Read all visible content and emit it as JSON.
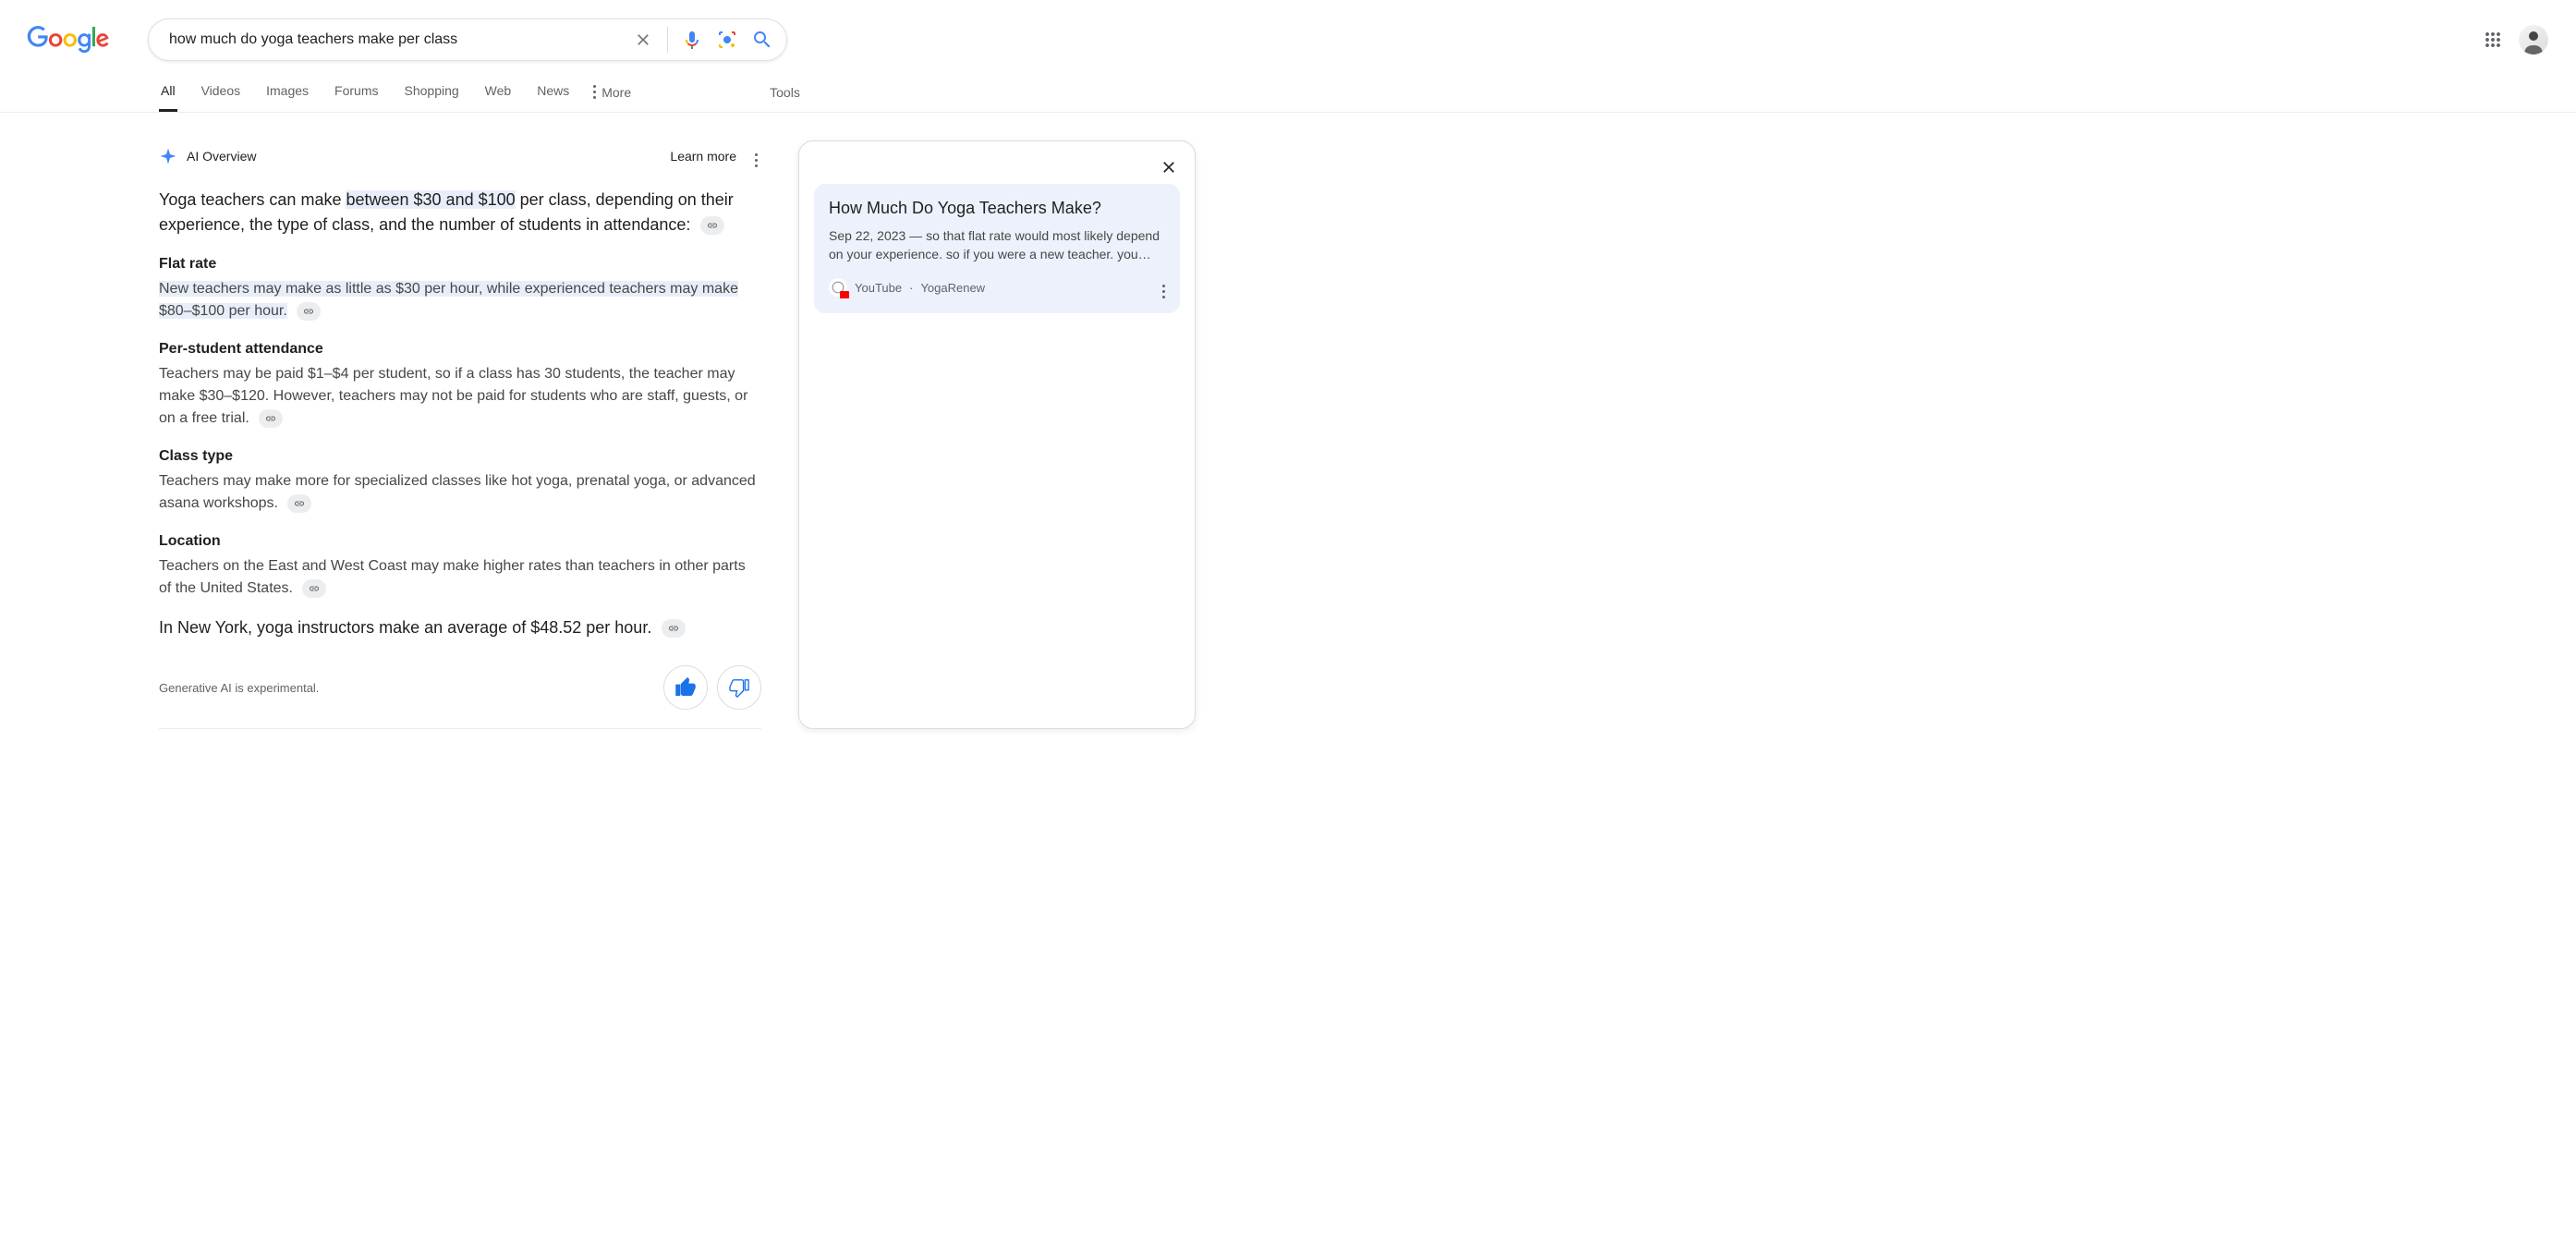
{
  "search": {
    "query": "how much do yoga teachers make per class"
  },
  "nav": {
    "tabs": [
      "All",
      "Videos",
      "Images",
      "Forums",
      "Shopping",
      "Web",
      "News"
    ],
    "more": "More",
    "tools": "Tools"
  },
  "ai": {
    "badge": "AI Overview",
    "learn_more": "Learn more",
    "intro_pre": "Yoga teachers can make ",
    "intro_hl1": "between $30 and $100",
    "intro_mid": " per class, depending on their experience, the type of class, and the number of students in attendance:",
    "sections": [
      {
        "title": "Flat rate",
        "body": "New teachers may make as little as $30 per hour, while experienced teachers may make $80–$100 per hour.",
        "highlighted": true
      },
      {
        "title": "Per-student attendance",
        "body": "Teachers may be paid $1–$4 per student, so if a class has 30 students, the teacher may make $30–$120. However, teachers may not be paid for students who are staff, guests, or on a free trial.",
        "highlighted": false
      },
      {
        "title": "Class type",
        "body": "Teachers may make more for specialized classes like hot yoga, prenatal yoga, or advanced asana workshops.",
        "highlighted": false
      },
      {
        "title": "Location",
        "body": "Teachers on the East and West Coast may make higher rates than teachers in other parts of the United States.",
        "highlighted": false
      }
    ],
    "closing": "In New York, yoga instructors make an average of $48.52 per hour.",
    "disclaimer": "Generative AI is experimental."
  },
  "source_card": {
    "title": "How Much Do Yoga Teachers Make?",
    "desc": "Sep 22, 2023 — so that flat rate would most likely depend on your experience. so if you were a new teacher. you…",
    "site": "YouTube",
    "author": "YogaRenew"
  }
}
